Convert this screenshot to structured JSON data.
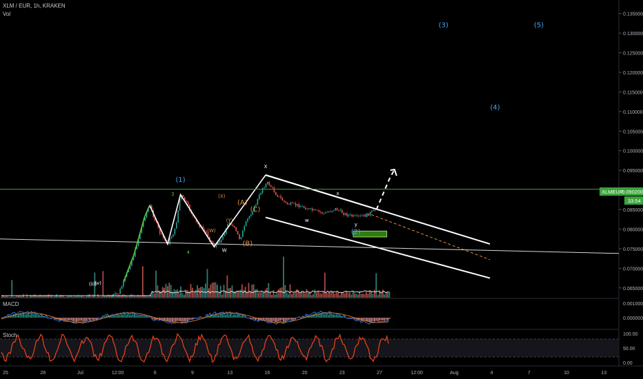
{
  "header": {
    "title": "XLM / EUR, 1h, KRAKEN",
    "vol_label": "Vol"
  },
  "price_tag": {
    "symbol": "XLMEUR",
    "price": "0.090200",
    "countdown": "33:54"
  },
  "panes": {
    "macd_label": "MACD",
    "stoch_label": "Stoch"
  },
  "colors": {
    "background": "#000000",
    "candle_up": "#26a69a",
    "candle_down": "#ef5350",
    "price_line": "#3aa33a",
    "wave_green": "#5bc236",
    "wave_cyan": "#3fa9f5",
    "wave_orange": "#e69138",
    "target_box": "#2e7d14",
    "stoch": "#e5411b"
  },
  "chart_data": {
    "type": "line",
    "title": "XLM / EUR, 1h, KRAKEN",
    "ylim": [
      0.0625,
      0.136
    ],
    "y_ticks": [
      "0.135000",
      "0.130000",
      "0.125000",
      "0.120000",
      "0.115000",
      "0.110000",
      "0.105000",
      "0.100000",
      "0.095000",
      "0.090000",
      "0.085000",
      "0.080000",
      "0.075000",
      "0.070000",
      "0.065000"
    ],
    "x_ticks": [
      "25",
      "28",
      "Jul",
      "12:00",
      "6",
      "9",
      "13",
      "16",
      "20",
      "23",
      "27",
      "12:00",
      "Aug",
      "4",
      "7",
      "10",
      "13"
    ],
    "macd_ticks": [
      "0.001000",
      "0.000000"
    ],
    "stoch_ticks": [
      "100.00",
      "50.00",
      "0.00"
    ],
    "price_path": [
      [
        4.3,
        0.0628
      ],
      [
        4.6,
        0.0636
      ],
      [
        4.8,
        0.0666
      ],
      [
        5.0,
        0.0702
      ],
      [
        5.2,
        0.0736
      ],
      [
        5.6,
        0.083
      ],
      [
        5.8,
        0.0861
      ],
      [
        6.2,
        0.079
      ],
      [
        6.5,
        0.0762
      ],
      [
        6.8,
        0.08
      ],
      [
        7.0,
        0.0888
      ],
      [
        7.2,
        0.087
      ],
      [
        7.6,
        0.0818
      ],
      [
        8.0,
        0.079
      ],
      [
        8.3,
        0.0755
      ],
      [
        8.6,
        0.0776
      ],
      [
        8.9,
        0.082
      ],
      [
        9.1,
        0.08
      ],
      [
        9.3,
        0.0775
      ],
      [
        9.6,
        0.0825
      ],
      [
        9.9,
        0.086
      ],
      [
        10.2,
        0.0908
      ],
      [
        10.4,
        0.0918
      ],
      [
        10.7,
        0.089
      ],
      [
        11.1,
        0.0865
      ],
      [
        11.6,
        0.086
      ],
      [
        12.1,
        0.0848
      ],
      [
        12.6,
        0.084
      ],
      [
        13.0,
        0.0852
      ],
      [
        13.4,
        0.0838
      ],
      [
        13.8,
        0.083
      ],
      [
        14.2,
        0.0835
      ],
      [
        14.6,
        0.085
      ]
    ],
    "projection_path": [
      [
        14.6,
        0.085
      ],
      [
        15.1,
        0.0928
      ],
      [
        15.3,
        0.0952
      ]
    ],
    "trendlines": [
      {
        "from": [
          10.3,
          0.0938
        ],
        "to": [
          19.0,
          0.0762
        ],
        "color": "#ffffff"
      },
      {
        "from": [
          10.3,
          0.083
        ],
        "to": [
          19.0,
          0.0675
        ],
        "color": "#ffffff"
      },
      {
        "from": [
          10.3,
          0.0938
        ],
        "to": [
          14.4,
          0.0855
        ],
        "color": "#ffffff"
      },
      {
        "from": [
          14.4,
          0.0837
        ],
        "to": [
          19.0,
          0.0722
        ],
        "color": "#e69138",
        "dashed": true
      },
      {
        "from": [
          0.0,
          0.0775
        ],
        "to": [
          24.0,
          0.0738
        ],
        "color": "#d9d9d9"
      }
    ],
    "target_zone": {
      "x0": 13.7,
      "x1": 15.0,
      "y0": 0.078,
      "y1": 0.0795
    },
    "current_price": 0.0902,
    "wave_labels": [
      {
        "text": "(1)",
        "x": 7.0,
        "y": 0.092,
        "color": "#3fa9f5"
      },
      {
        "text": "(3)",
        "x": 17.2,
        "y": 0.1315,
        "color": "#3fa9f5"
      },
      {
        "text": "(4)",
        "x": 19.2,
        "y": 0.1105,
        "color": "#3fa9f5"
      },
      {
        "text": "(5)",
        "x": 20.9,
        "y": 0.1315,
        "color": "#3fa9f5"
      },
      {
        "text": "(2)",
        "x": 13.8,
        "y": 0.0788,
        "color": "#3fa9f5"
      },
      {
        "text": "3",
        "x": 6.7,
        "y": 0.0885,
        "color": "#5bc236"
      },
      {
        "text": "4",
        "x": 7.3,
        "y": 0.0737,
        "color": "#5bc236"
      },
      {
        "text": "W",
        "x": 8.7,
        "y": 0.0742,
        "color": "#ffffff"
      },
      {
        "text": "(W)",
        "x": 8.2,
        "y": 0.0792,
        "color": "#e69138"
      },
      {
        "text": "(X)",
        "x": 8.6,
        "y": 0.088,
        "color": "#e69138"
      },
      {
        "text": "(Y)",
        "x": 8.9,
        "y": 0.0818,
        "color": "#e69138"
      },
      {
        "text": "(A)",
        "x": 9.4,
        "y": 0.0862,
        "color": "#e69138"
      },
      {
        "text": "(B)",
        "x": 9.6,
        "y": 0.0758,
        "color": "#e69138"
      },
      {
        "text": "(C)",
        "x": 9.9,
        "y": 0.0845,
        "color": "#e69138"
      },
      {
        "text": "X",
        "x": 10.3,
        "y": 0.0956,
        "color": "#ffffff"
      },
      {
        "text": "w",
        "x": 11.9,
        "y": 0.0818,
        "color": "#ffffff"
      },
      {
        "text": "x",
        "x": 13.1,
        "y": 0.0887,
        "color": "#ffffff"
      },
      {
        "text": "y",
        "x": 13.8,
        "y": 0.0808,
        "color": "#ffffff"
      },
      {
        "text": "(iii)",
        "x": 3.6,
        "y": 0.0656,
        "color": "#ffffff"
      },
      {
        "text": "(v)",
        "x": 3.8,
        "y": 0.0658,
        "color": "#ffffff"
      }
    ],
    "grid": false,
    "legend": "none"
  }
}
